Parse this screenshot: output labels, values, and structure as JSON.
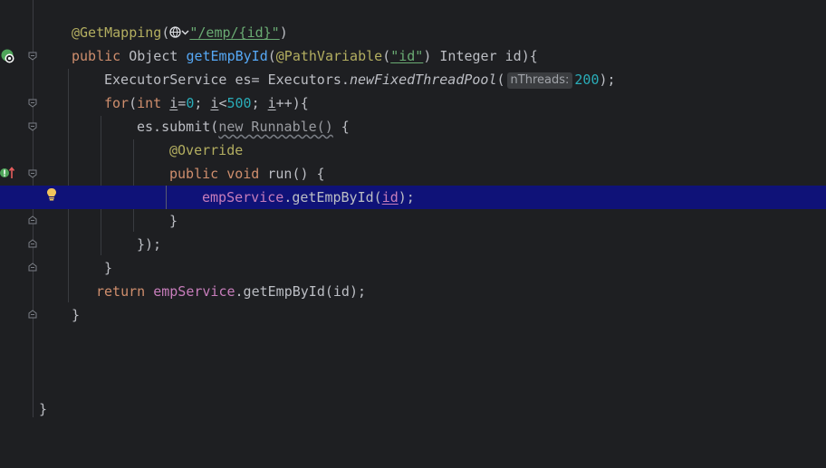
{
  "editor": {
    "lines": {
      "l1": {
        "ann": "@GetMapping",
        "p1": "(",
        "str": "\"/emp/{id}\"",
        "p2": ")"
      },
      "l2": {
        "kw": "public",
        "t1": " Object ",
        "fn": "getEmpById",
        "p1": "(",
        "ann": "@PathVariable",
        "p2": "(",
        "str": "\"id\"",
        "p3": ") Integer id){"
      },
      "l3": {
        "t1": "ExecutorService es= Executors.",
        "method": "newFixedThreadPool",
        "p1": "(",
        "hint": "nThreads:",
        "num": "200",
        "p2": ");"
      },
      "l4": {
        "kw1": "for",
        "p1": "(",
        "kw2": "int",
        "v1": "i",
        "t1": "=",
        "n1": "0",
        "t2": "; ",
        "v2": "i",
        "t3": "<",
        "n2": "500",
        "t4": "; ",
        "v3": "i",
        "t5": "++){"
      },
      "l5": {
        "t1": "es.submit(",
        "wavy": "new Runnable()",
        "t2": " {"
      },
      "l6": {
        "ann": "@Override"
      },
      "l7": {
        "kw": "public void",
        "t1": " run() {"
      },
      "l8": {
        "fld": "empService",
        "t1": ".getEmpById(",
        "v": "id",
        "t2": ");"
      },
      "l9": {
        "t1": "}"
      },
      "l10": {
        "t1": "});"
      },
      "l11": {
        "t1": "}"
      },
      "l12": {
        "kw": "return",
        "sp": " ",
        "fld": "empService",
        "t1": ".getEmpById(id);"
      },
      "l13": {
        "t1": "}"
      },
      "l17": {
        "t1": "}"
      }
    }
  },
  "colors": {
    "background": "#1e1f22",
    "highlight_line": "#0f1278",
    "annotation": "#b3ae60",
    "keyword": "#cf8e6d",
    "string": "#6aab73",
    "number": "#2aacb8",
    "field": "#c77dbb"
  },
  "icons": {
    "run": "run-gutter-icon",
    "implement": "implementing-method-icon",
    "bulb": "lightbulb-icon",
    "globe": "web-globe-icon"
  }
}
